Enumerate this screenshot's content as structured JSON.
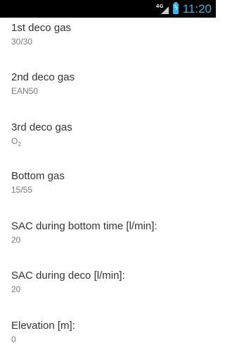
{
  "status_bar": {
    "network_label": "4G",
    "time": "11:20",
    "signal_icon": "signal-icon",
    "battery_icon": "battery-charging-icon",
    "accent_color": "#33b5e5"
  },
  "settings": {
    "items": [
      {
        "title": "1st deco gas",
        "value": "30/30"
      },
      {
        "title": "2nd deco gas",
        "value": "EAN50"
      },
      {
        "title": "3rd deco gas",
        "value_main": "O",
        "value_sub": "2"
      },
      {
        "title": "Bottom gas",
        "value": "15/55"
      },
      {
        "title": "SAC during bottom time [l/min]:",
        "value": "20"
      },
      {
        "title": "SAC during deco [l/min]:",
        "value": "20"
      },
      {
        "title": "Elevation [m]:",
        "value": "0"
      }
    ]
  }
}
